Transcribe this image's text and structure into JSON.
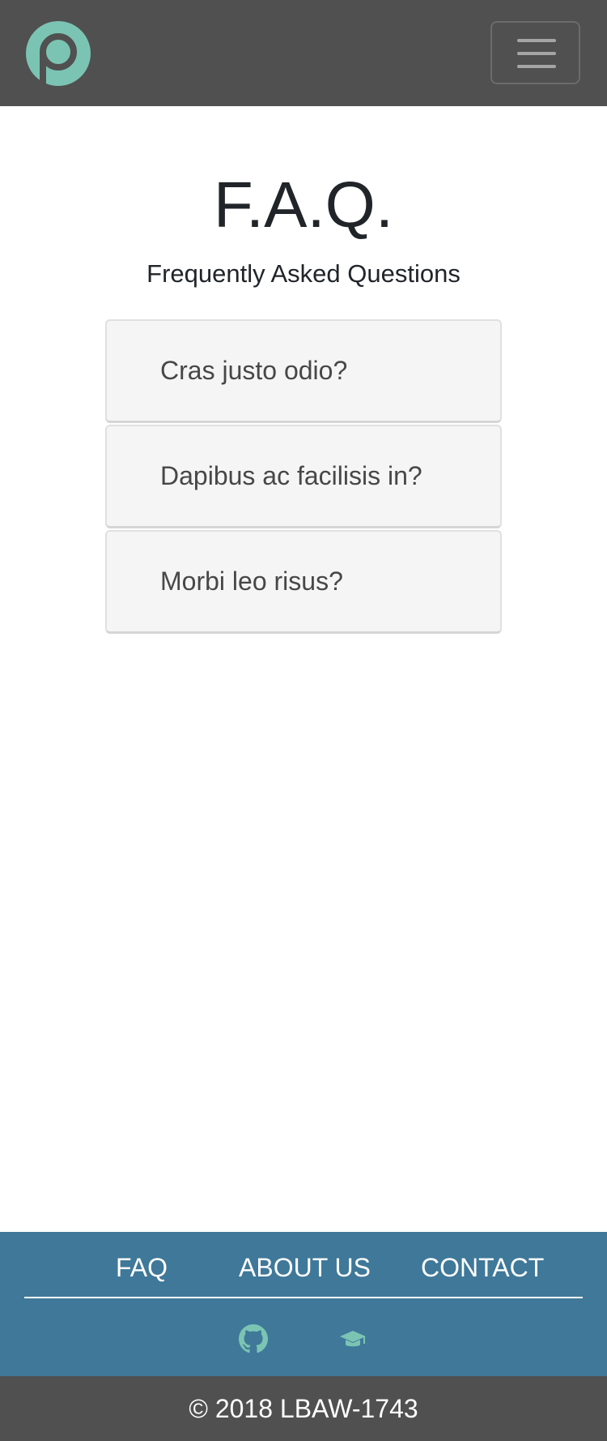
{
  "header": {
    "logo_icon": "brand-p-logo-icon",
    "menu_icon": "hamburger-menu-icon",
    "brand_color": "#7bc4b3"
  },
  "main": {
    "title": "F.A.Q.",
    "subtitle": "Frequently Asked Questions",
    "questions": [
      {
        "label": "Cras justo odio?"
      },
      {
        "label": "Dapibus ac facilisis in?"
      },
      {
        "label": "Morbi leo risus?"
      }
    ]
  },
  "footer": {
    "links": [
      {
        "label": "FAQ"
      },
      {
        "label": "ABOUT US"
      },
      {
        "label": "CONTACT"
      }
    ],
    "icons": [
      "github-icon",
      "graduation-cap-icon"
    ],
    "accent_color": "#3f7899",
    "copyright": "© 2018 LBAW-1743"
  }
}
